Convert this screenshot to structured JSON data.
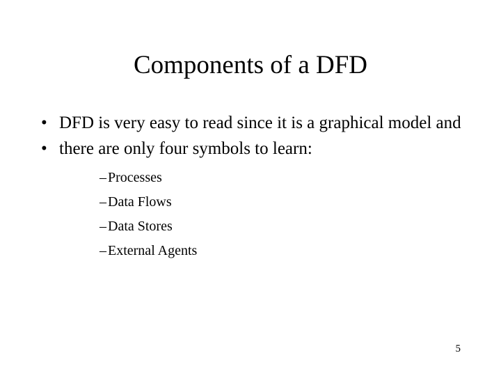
{
  "slide": {
    "title": "Components of a DFD",
    "background_color": "#ffffff",
    "text_color": "#000000",
    "page_number": "5",
    "bullets": [
      {
        "marker": "•",
        "text": "DFD is very easy to read since it is a graphical model and",
        "sub_marker": "",
        "sub_items": []
      },
      {
        "marker": "•",
        "text": "there are only four symbols to learn:",
        "sub_marker": "–",
        "sub_items": [
          {
            "marker": "–",
            "text": "Processes"
          },
          {
            "marker": "–",
            "text": "Data Flows"
          },
          {
            "marker": "–",
            "text": "Data Stores"
          },
          {
            "marker": "–",
            "text": "External Agents"
          }
        ]
      }
    ]
  }
}
